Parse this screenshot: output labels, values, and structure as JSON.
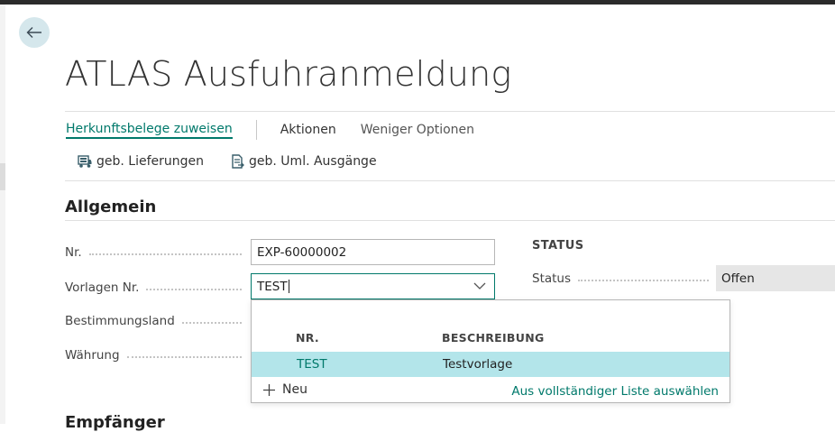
{
  "page": {
    "title": "ATLAS Ausfuhranmeldung"
  },
  "actions": {
    "primary": "Herkunftsbelege zuweisen",
    "actions": "Aktionen",
    "fewer_options": "Weniger Optionen"
  },
  "sub_actions": [
    {
      "label": "geb. Lieferungen",
      "icon": "truck-document-icon"
    },
    {
      "label": "geb. Uml. Ausgänge",
      "icon": "transfer-document-icon"
    }
  ],
  "general": {
    "title": "Allgemein",
    "fields": {
      "nr": {
        "label": "Nr.",
        "value": "EXP-60000002"
      },
      "template": {
        "label": "Vorlagen Nr.",
        "value": "TEST"
      },
      "destination": {
        "label": "Bestimmungsland"
      },
      "currency": {
        "label": "Währung"
      }
    }
  },
  "status_group": {
    "heading": "STATUS",
    "label": "Status",
    "value": "Offen"
  },
  "lookup": {
    "columns": [
      "NR.",
      "BESCHREIBUNG"
    ],
    "rows": [
      {
        "nr": "TEST",
        "description": "Testvorlage"
      }
    ],
    "new_label": "Neu",
    "full_list_label": "Aus vollständiger Liste auswählen"
  },
  "next_section": {
    "title": "Empfänger"
  },
  "colors": {
    "accent": "#00796b",
    "selected_row": "#b3e5ea",
    "back_button": "#d5e7ec"
  }
}
